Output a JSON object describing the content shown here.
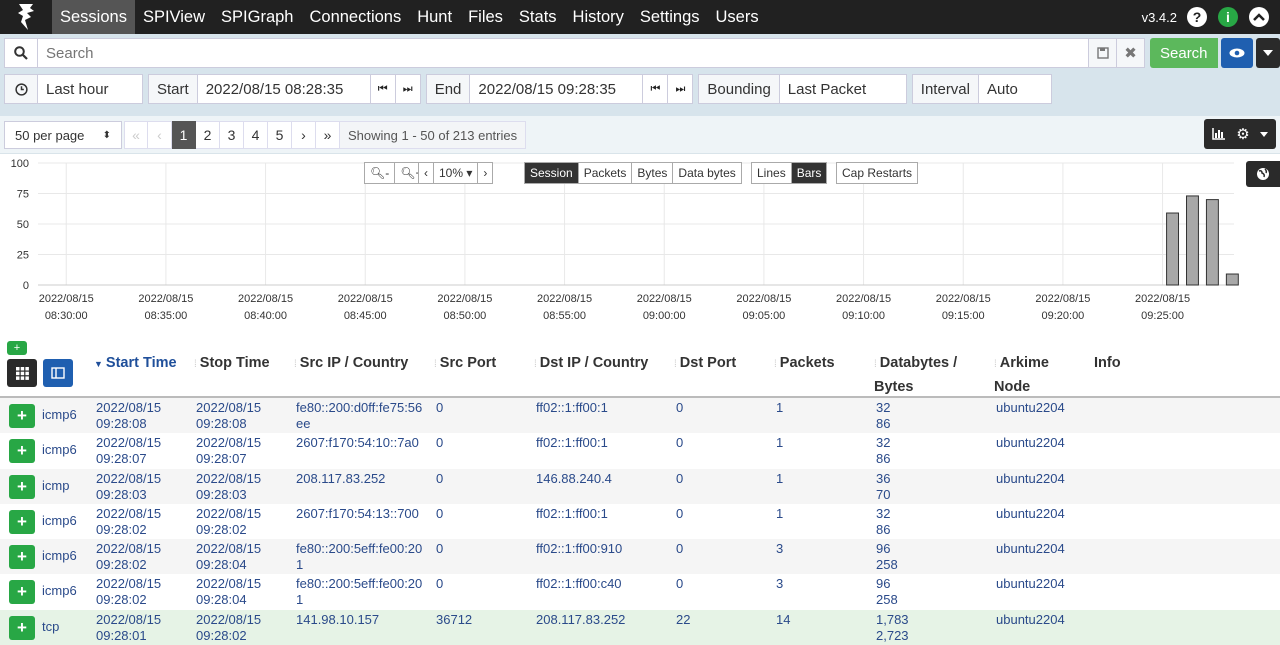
{
  "nav": {
    "items": [
      "Sessions",
      "SPIView",
      "SPIGraph",
      "Connections",
      "Hunt",
      "Files",
      "Stats",
      "History",
      "Settings",
      "Users"
    ],
    "version": "v3.4.2"
  },
  "search": {
    "placeholder": "Search",
    "button": "Search"
  },
  "time": {
    "range": "Last hour",
    "start_label": "Start",
    "start_value": "2022/08/15 08:28:35",
    "end_label": "End",
    "end_value": "2022/08/15 09:28:35",
    "bounding_label": "Bounding",
    "bounding_value": "Last Packet",
    "interval_label": "Interval",
    "interval_value": "Auto"
  },
  "pager": {
    "per_page": "50 per page",
    "pages": [
      "«",
      "‹",
      "1",
      "2",
      "3",
      "4",
      "5",
      "›",
      "»"
    ],
    "showing": "Showing 1 - 50 of 213 entries"
  },
  "chart_controls": {
    "zoom": "10%",
    "metrics": [
      "Session",
      "Packets",
      "Bytes",
      "Data bytes"
    ],
    "styles": [
      "Lines",
      "Bars"
    ],
    "cap": "Cap Restarts"
  },
  "chart_data": {
    "type": "bar",
    "y_ticks": [
      "100",
      "75",
      "50",
      "25",
      "0"
    ],
    "ylim": [
      0,
      100
    ],
    "x_ticks": [
      [
        "2022/08/15",
        "08:30:00"
      ],
      [
        "2022/08/15",
        "08:35:00"
      ],
      [
        "2022/08/15",
        "08:40:00"
      ],
      [
        "2022/08/15",
        "08:45:00"
      ],
      [
        "2022/08/15",
        "08:50:00"
      ],
      [
        "2022/08/15",
        "08:55:00"
      ],
      [
        "2022/08/15",
        "09:00:00"
      ],
      [
        "2022/08/15",
        "09:05:00"
      ],
      [
        "2022/08/15",
        "09:10:00"
      ],
      [
        "2022/08/15",
        "09:15:00"
      ],
      [
        "2022/08/15",
        "09:20:00"
      ],
      [
        "2022/08/15",
        "09:25:00"
      ]
    ],
    "bars": [
      {
        "minute": "09:25",
        "value": 59
      },
      {
        "minute": "09:26",
        "value": 73
      },
      {
        "minute": "09:27",
        "value": 70
      },
      {
        "minute": "09:28",
        "value": 9
      }
    ]
  },
  "table": {
    "headers": [
      "Start Time",
      "Stop Time",
      "Src IP / Country",
      "Src Port",
      "Dst IP / Country",
      "Dst Port",
      "Packets",
      "Databytes /",
      "Bytes",
      "Arkime",
      "Node",
      "Info"
    ],
    "rows": [
      {
        "proto": "icmp6",
        "start": [
          "2022/08/15",
          "09:28:08"
        ],
        "stop": [
          "2022/08/15",
          "09:28:08"
        ],
        "src": [
          "fe80::200:d0ff:fe75:56",
          "ee"
        ],
        "sport": "0",
        "dst": "ff02::1:ff00:1",
        "dport": "0",
        "packets": "1",
        "db": [
          "32",
          "86"
        ],
        "node": "ubuntu2204"
      },
      {
        "proto": "icmp6",
        "start": [
          "2022/08/15",
          "09:28:07"
        ],
        "stop": [
          "2022/08/15",
          "09:28:07"
        ],
        "src": [
          "2607:f170:54:10::7a0",
          ""
        ],
        "sport": "0",
        "dst": "ff02::1:ff00:1",
        "dport": "0",
        "packets": "1",
        "db": [
          "32",
          "86"
        ],
        "node": "ubuntu2204"
      },
      {
        "proto": "icmp",
        "start": [
          "2022/08/15",
          "09:28:03"
        ],
        "stop": [
          "2022/08/15",
          "09:28:03"
        ],
        "src": [
          "208.117.83.252",
          ""
        ],
        "sport": "0",
        "dst": "146.88.240.4",
        "dport": "0",
        "packets": "1",
        "db": [
          "36",
          "70"
        ],
        "node": "ubuntu2204"
      },
      {
        "proto": "icmp6",
        "start": [
          "2022/08/15",
          "09:28:02"
        ],
        "stop": [
          "2022/08/15",
          "09:28:02"
        ],
        "src": [
          "2607:f170:54:13::700",
          ""
        ],
        "sport": "0",
        "dst": "ff02::1:ff00:1",
        "dport": "0",
        "packets": "1",
        "db": [
          "32",
          "86"
        ],
        "node": "ubuntu2204"
      },
      {
        "proto": "icmp6",
        "start": [
          "2022/08/15",
          "09:28:02"
        ],
        "stop": [
          "2022/08/15",
          "09:28:04"
        ],
        "src": [
          "fe80::200:5eff:fe00:20",
          "1"
        ],
        "sport": "0",
        "dst": "ff02::1:ff00:910",
        "dport": "0",
        "packets": "3",
        "db": [
          "96",
          "258"
        ],
        "node": "ubuntu2204"
      },
      {
        "proto": "icmp6",
        "start": [
          "2022/08/15",
          "09:28:02"
        ],
        "stop": [
          "2022/08/15",
          "09:28:04"
        ],
        "src": [
          "fe80::200:5eff:fe00:20",
          "1"
        ],
        "sport": "0",
        "dst": "ff02::1:ff00:c40",
        "dport": "0",
        "packets": "3",
        "db": [
          "96",
          "258"
        ],
        "node": "ubuntu2204"
      },
      {
        "proto": "tcp",
        "start": [
          "2022/08/15",
          "09:28:01"
        ],
        "stop": [
          "2022/08/15",
          "09:28:02"
        ],
        "src": [
          "141.98.10.157",
          ""
        ],
        "sport": "36712",
        "dst": "208.117.83.252",
        "dport": "22",
        "packets": "14",
        "db": [
          "1,783",
          "2,723"
        ],
        "node": "ubuntu2204"
      }
    ]
  },
  "colors": {
    "nav_bg": "#212121",
    "search_green": "#5cb85c",
    "eye_blue": "#1f5fb0",
    "plus_green": "#28a745",
    "link_blue": "#2a4a8a"
  }
}
